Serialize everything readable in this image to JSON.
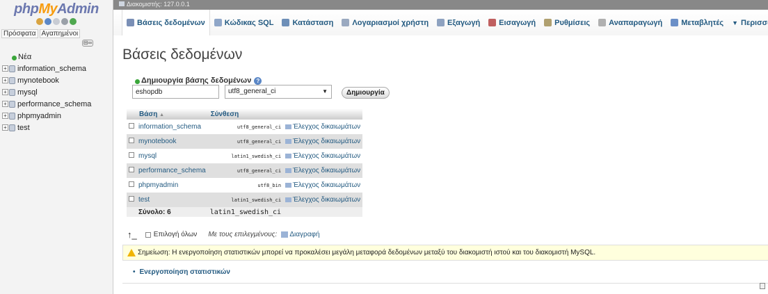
{
  "logo": {
    "php": "php",
    "my": "My",
    "admin": "Admin"
  },
  "nav": {
    "recent": "Πρόσφατα",
    "favorites": "Αγαπημένοι"
  },
  "tree": {
    "new_label": "Νέα",
    "databases": [
      "information_schema",
      "mynotebook",
      "mysql",
      "performance_schema",
      "phpmyadmin",
      "test"
    ]
  },
  "serverbar": {
    "label": "Διακομιστής: 127.0.0.1"
  },
  "menu": {
    "items": [
      {
        "label": "Βάσεις δεδομένων",
        "icon": "database-icon",
        "color": "#7a8fb6"
      },
      {
        "label": "Κώδικας SQL",
        "icon": "sql-icon",
        "color": "#8fa6c8"
      },
      {
        "label": "Κατάσταση",
        "icon": "status-icon",
        "color": "#6e8fb8"
      },
      {
        "label": "Λογαριασμοί χρήστη",
        "icon": "users-icon",
        "color": "#9aa9c0"
      },
      {
        "label": "Εξαγωγή",
        "icon": "export-icon",
        "color": "#8ea2c0"
      },
      {
        "label": "Εισαγωγή",
        "icon": "import-icon",
        "color": "#c06060"
      },
      {
        "label": "Ρυθμίσεις",
        "icon": "wrench-icon",
        "color": "#b0a070"
      },
      {
        "label": "Αναπαραγωγή",
        "icon": "replication-icon",
        "color": "#b0b0b0"
      },
      {
        "label": "Μεταβλητές",
        "icon": "variables-icon",
        "color": "#6b8fc7"
      },
      {
        "label": "Περισσότερα",
        "icon": "more-icon",
        "color": "#333333"
      }
    ]
  },
  "main": {
    "title": "Βάσεις δεδομένων",
    "create_label": "Δημιουργία βάσης δεδομένων",
    "db_name_value": "eshopdb",
    "collation_value": "utf8_general_ci",
    "create_button": "Δημιουργία"
  },
  "table": {
    "headers": {
      "database": "Βάση",
      "collation": "Σύνθεση"
    },
    "rows": [
      {
        "name": "information_schema",
        "collation": "utf8_general_ci",
        "priv": "Έλεγχος δικαιωμάτων"
      },
      {
        "name": "mynotebook",
        "collation": "utf8_general_ci",
        "priv": "Έλεγχος δικαιωμάτων"
      },
      {
        "name": "mysql",
        "collation": "latin1_swedish_ci",
        "priv": "Έλεγχος δικαιωμάτων"
      },
      {
        "name": "performance_schema",
        "collation": "utf8_general_ci",
        "priv": "Έλεγχος δικαιωμάτων"
      },
      {
        "name": "phpmyadmin",
        "collation": "utf8_bin",
        "priv": "Έλεγχος δικαιωμάτων"
      },
      {
        "name": "test",
        "collation": "latin1_swedish_ci",
        "priv": "Έλεγχος δικαιωμάτων"
      }
    ],
    "total_label": "Σύνολο: 6",
    "total_collation": "latin1_swedish_ci"
  },
  "bulk": {
    "select_all": "Επιλογή όλων",
    "with_selected": "Με τους επιλεγμένους:",
    "drop": "Διαγραφή"
  },
  "notice": {
    "text": "Σημείωση: Η ενεργοποίηση στατιστικών μπορεί να προκαλέσει μεγάλη μεταφορά δεδομένων μεταξύ του διακομιστή ιστού και του διακομιστή MySQL."
  },
  "enable_stats": "Ενεργοποίηση στατιστικών"
}
